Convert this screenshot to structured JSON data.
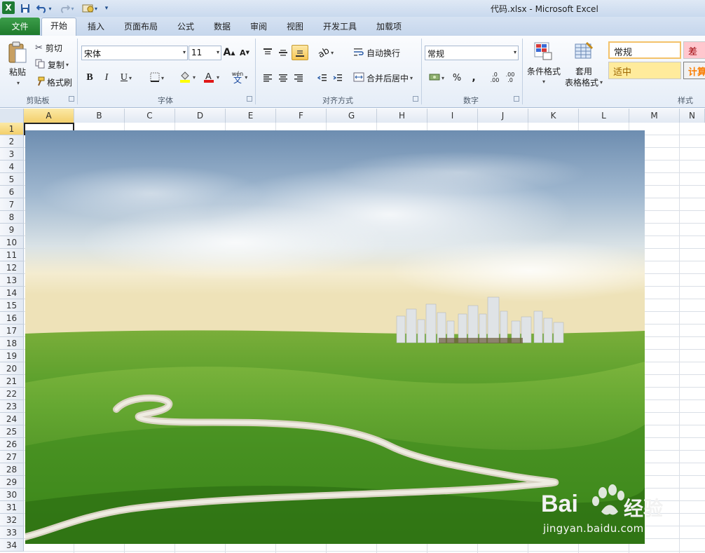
{
  "window": {
    "title": "代码.xlsx - Microsoft Excel",
    "app_icon": "excel-x-icon",
    "quick_access": [
      "save-icon",
      "undo-icon",
      "redo-icon",
      "macro-icon",
      "customize-icon"
    ]
  },
  "tabs": {
    "file": "文件",
    "items": [
      "开始",
      "插入",
      "页面布局",
      "公式",
      "数据",
      "审阅",
      "视图",
      "开发工具",
      "加载项"
    ],
    "active": "开始"
  },
  "ribbon": {
    "clipboard": {
      "paste": "粘贴",
      "cut": "剪切",
      "copy": "复制",
      "format_painter": "格式刷",
      "label": "剪贴板"
    },
    "font": {
      "name": "宋体",
      "size": "11",
      "bold": "B",
      "italic": "I",
      "underline": "U",
      "grow": "A",
      "shrink": "A",
      "phonetic": "wén",
      "label": "字体"
    },
    "alignment": {
      "wrap": "自动换行",
      "merge": "合并后居中",
      "label": "对齐方式"
    },
    "number": {
      "format": "常规",
      "percent": "%",
      "comma": ",",
      "inc_dec_a": ".0",
      "inc_dec_b": ".00",
      "label": "数字"
    },
    "styles": {
      "conditional": "条件格式",
      "table_format_1": "套用",
      "table_format_2": "表格格式",
      "normal": "常规",
      "bad": "差",
      "neutral": "适中",
      "calc": "计算",
      "label": "样式"
    }
  },
  "grid": {
    "columns": [
      "A",
      "B",
      "C",
      "D",
      "E",
      "F",
      "G",
      "H",
      "I",
      "J",
      "K",
      "L",
      "M",
      "N"
    ],
    "rows": [
      "1",
      "2",
      "3",
      "4",
      "5",
      "6",
      "7",
      "8",
      "9",
      "10",
      "11",
      "12",
      "13",
      "14",
      "15",
      "16",
      "17",
      "18",
      "19",
      "20",
      "21",
      "22",
      "23",
      "24",
      "25",
      "26",
      "27",
      "28",
      "29",
      "30",
      "31",
      "32",
      "33",
      "34"
    ],
    "selected_cell": "A1"
  },
  "watermark": {
    "brand": "Bai",
    "brand2": "经验",
    "url": "jingyan.baidu.com"
  },
  "colors": {
    "file_tab": "#1e7a2c",
    "selected_header": "#f3cf6b",
    "style_bad_bg": "#ffc7ce",
    "style_bad_text": "#9c0006",
    "style_neutral_bg": "#ffeb9c",
    "style_neutral_text": "#9c6500"
  }
}
